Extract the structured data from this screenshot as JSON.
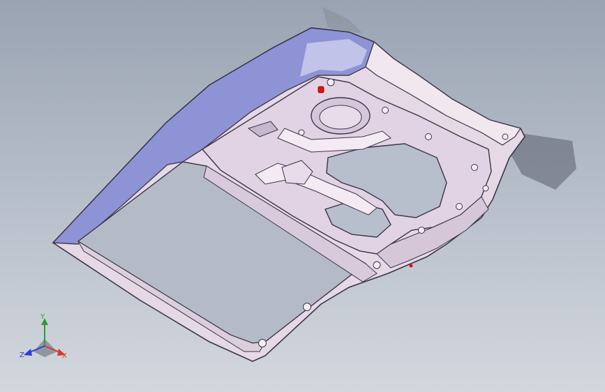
{
  "viewport": {
    "background_top": "#9aa3b2",
    "background_bottom": "#d3d7de",
    "model_name": "car-door-inner-panel"
  },
  "colors": {
    "panel_face": "#e6d9e6",
    "panel_edge": "#3a3448",
    "selected_face": "#8a90d6",
    "marker": "#e01010"
  },
  "triad": {
    "x_label": "X",
    "y_label": "Y",
    "z_label": "Z",
    "x_color": "#d63a2b",
    "y_color": "#2e9a3c",
    "z_color": "#2b3fd6"
  }
}
